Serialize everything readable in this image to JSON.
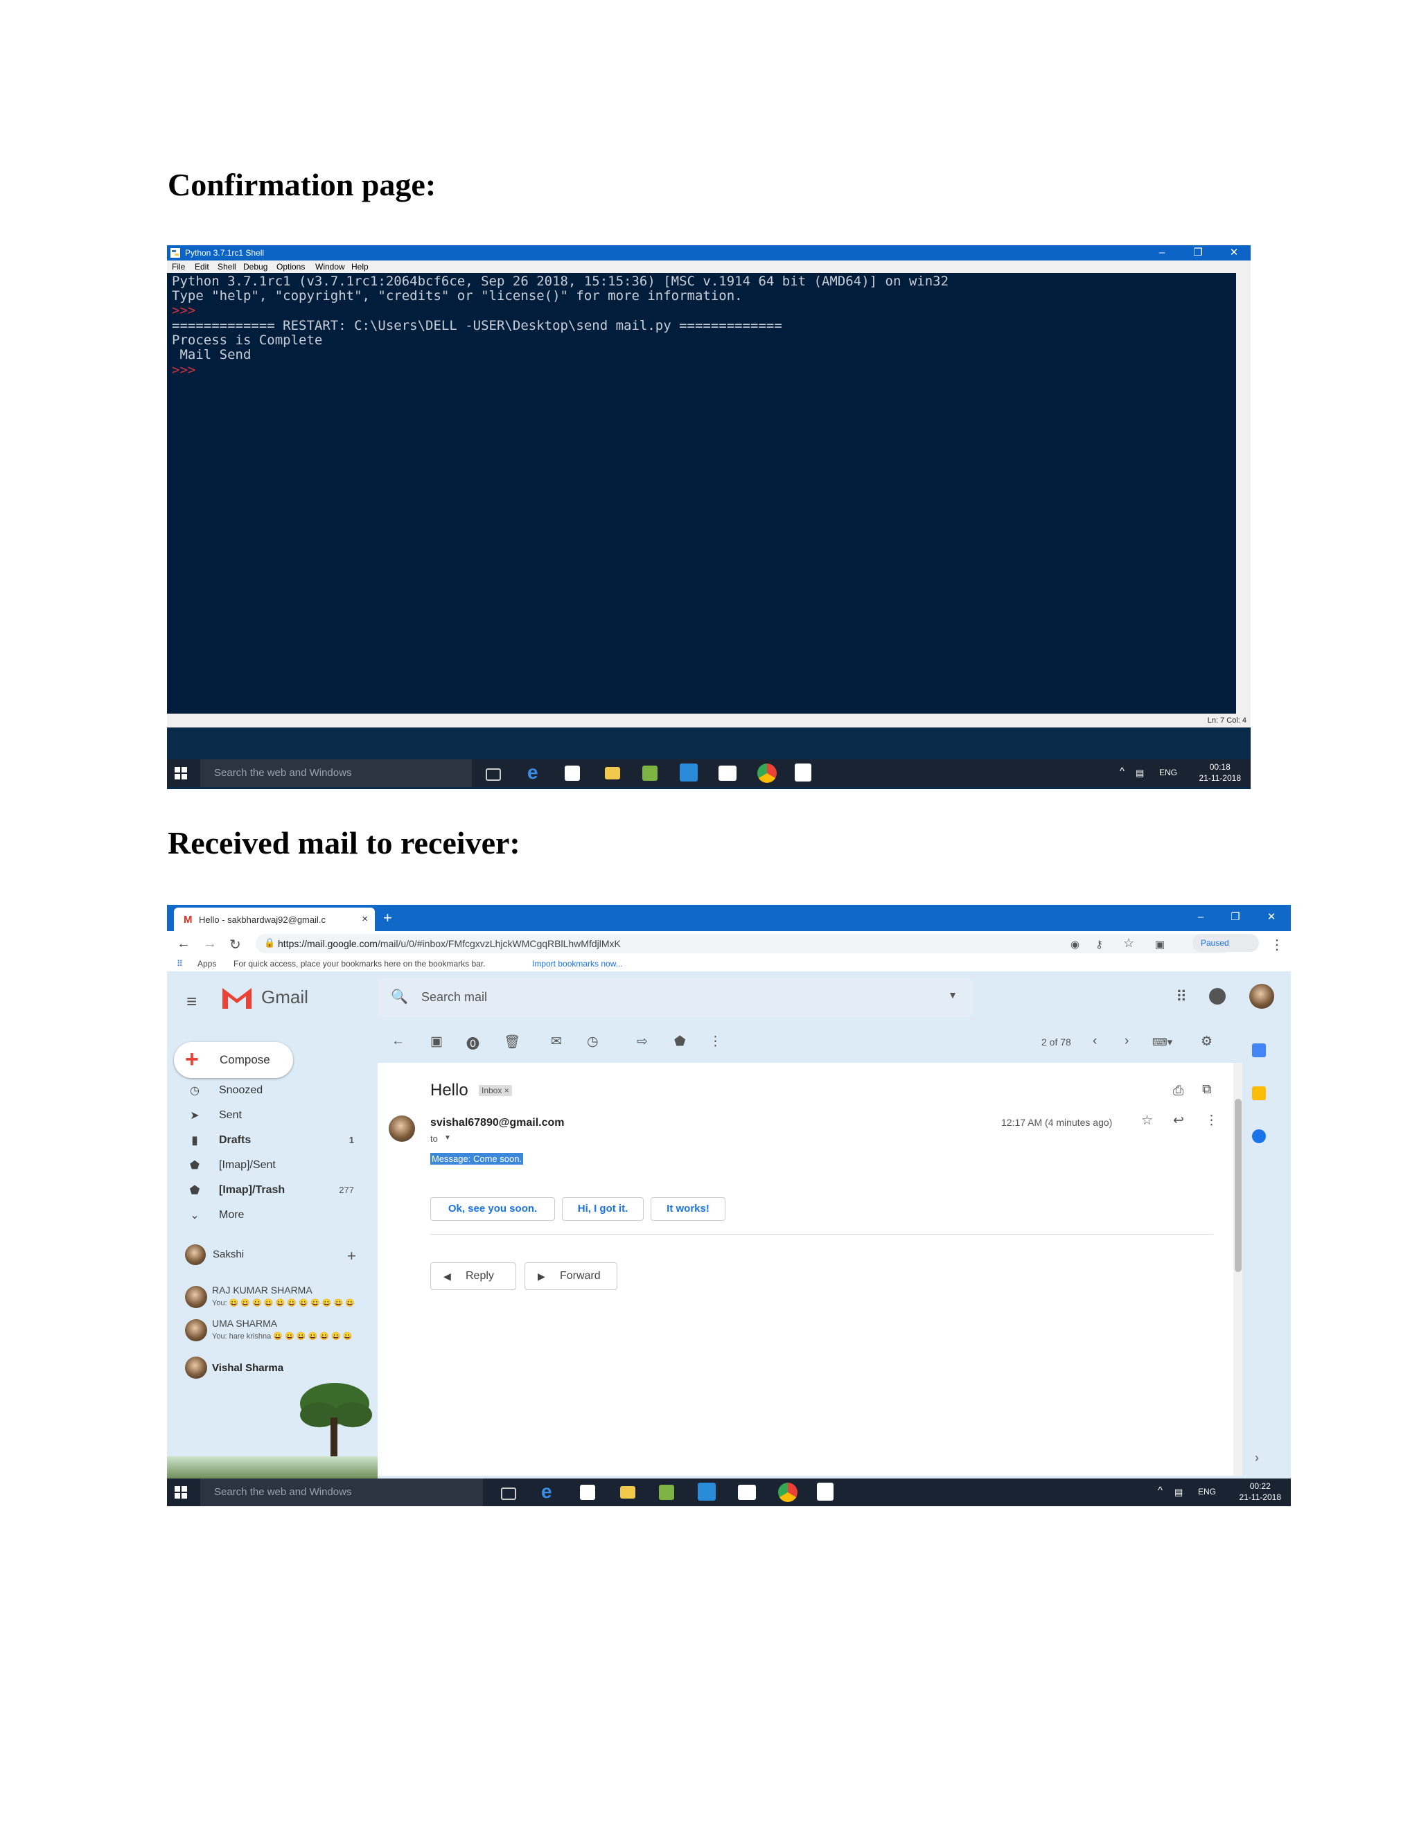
{
  "headings": {
    "confirmation": "Confirmation page:",
    "received": "Received mail to receiver:"
  },
  "python_shell": {
    "title": "Python 3.7.1rc1 Shell",
    "menu": [
      "File",
      "Edit",
      "Shell",
      "Debug",
      "Options",
      "Window",
      "Help"
    ],
    "console_lines": [
      "Python 3.7.1rc1 (v3.7.1rc1:2064bcf6ce, Sep 26 2018, 15:15:36) [MSC v.1914 64 bit (AMD64)] on win32",
      "Type \"help\", \"copyright\", \"credits\" or \"license()\" for more information.",
      ">>> ",
      "============= RESTART: C:\\Users\\DELL -USER\\Desktop\\send mail.py =============",
      "Process is Complete",
      " Mail Send",
      ">>> "
    ],
    "status": "Ln: 7   Col: 4"
  },
  "taskbar1": {
    "search_placeholder": "Search the web and Windows",
    "lang": "ENG",
    "time": "00:18",
    "date": "21-11-2018"
  },
  "browser": {
    "tab_title": "Hello - sakbhardwaj92@gmail.c",
    "url_host": "https://mail.google.com",
    "url_path": "/mail/u/0/#inbox/FMfcgxvzLhjckWMCgqRBlLhwMfdjlMxK",
    "profile_status": "Paused",
    "bookmarks_apps": "Apps",
    "bookmarks_hint": "For quick access, place your bookmarks here on the bookmarks bar.",
    "bookmarks_link": "Import bookmarks now..."
  },
  "gmail": {
    "product_name": "Gmail",
    "search_placeholder": "Search mail",
    "compose_label": "Compose",
    "sidebar": [
      {
        "label": "Snoozed",
        "count": "",
        "icon": "clock-icon"
      },
      {
        "label": "Sent",
        "count": "",
        "icon": "send-icon"
      },
      {
        "label": "Drafts",
        "count": "1",
        "icon": "draft-icon"
      },
      {
        "label": "[Imap]/Sent",
        "count": "",
        "icon": "label-icon"
      },
      {
        "label": "[Imap]/Trash",
        "count": "277",
        "icon": "label-icon"
      },
      {
        "label": "More",
        "count": "",
        "icon": "chevron-down-icon"
      }
    ],
    "chat_user": "Sakshi",
    "contacts": [
      {
        "name": "RAJ KUMAR SHARMA",
        "snippet": "You: 😀 😀 😀 😀 😀 😀 😀 😀 😀 😀 😀"
      },
      {
        "name": "UMA SHARMA",
        "snippet": "You: hare krishna 😀 😀 😀 😀 😀 😀 😀"
      },
      {
        "name": "Vishal Sharma",
        "snippet": ""
      }
    ],
    "pager": "2 of 78",
    "subject": "Hello",
    "label_chip": "Inbox ×",
    "sender": "svishal67890@gmail.com",
    "to": "to",
    "time": "12:17 AM (4 minutes ago)",
    "message": "Message: Come soon.",
    "smart_replies": [
      "Ok, see you soon.",
      "Hi, I got it.",
      "It works!"
    ],
    "reply_label": "Reply",
    "forward_label": "Forward"
  },
  "taskbar2": {
    "search_placeholder": "Search the web and Windows",
    "lang": "ENG",
    "time": "00:22",
    "date": "21-11-2018"
  },
  "colors": {
    "python_bg": "#001e3c",
    "titlebar_blue": "#0b63c6",
    "chrome_blue": "#1068c8",
    "gmail_theme": "#dcebf6",
    "link_blue": "#1a73e8",
    "taskbar": "#1a2331"
  }
}
